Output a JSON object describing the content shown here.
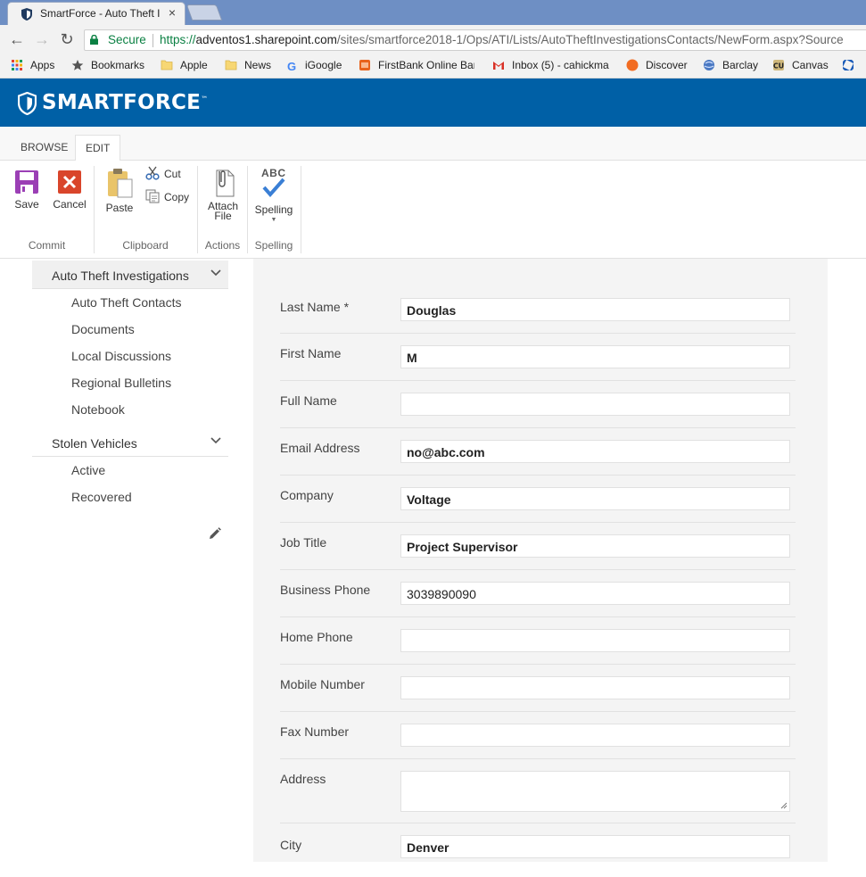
{
  "browser": {
    "tab_title": "SmartForce - Auto Theft I",
    "url_secure": "Secure",
    "url_scheme": "https://",
    "url_host": "adventos1.sharepoint.com",
    "url_path": "/sites/smartforce2018-1/Ops/ATI/Lists/AutoTheftInvestigationsContacts/NewForm.aspx?Source",
    "bookmarks": [
      {
        "label": "Apps",
        "icon": "apps-grid-icon"
      },
      {
        "label": "Bookmarks",
        "icon": "star-icon"
      },
      {
        "label": "Apple",
        "icon": "folder-icon"
      },
      {
        "label": "News",
        "icon": "folder-icon"
      },
      {
        "label": "iGoogle",
        "icon": "google-icon"
      },
      {
        "label": "FirstBank Online Ban",
        "icon": "firstbank-icon"
      },
      {
        "label": "Inbox (5) - cahickma",
        "icon": "gmail-icon"
      },
      {
        "label": "Discover",
        "icon": "discover-icon"
      },
      {
        "label": "Barclay",
        "icon": "globe-icon"
      },
      {
        "label": "Canvas",
        "icon": "cu-icon"
      }
    ]
  },
  "suite": {
    "brand": "SMARTFORCE",
    "trademark": "™"
  },
  "ribbon": {
    "tabs": [
      "BROWSE",
      "EDIT"
    ],
    "active_tab": "EDIT",
    "save": "Save",
    "cancel": "Cancel",
    "paste": "Paste",
    "cut": "Cut",
    "copy": "Copy",
    "attach_line1": "Attach",
    "attach_line2": "File",
    "spelling": "Spelling",
    "spelling_icon_text": "ABC",
    "groups": [
      "Commit",
      "Clipboard",
      "Actions",
      "Spelling"
    ]
  },
  "leftnav": {
    "section1": "Auto Theft Investigations",
    "section1_items": [
      "Auto Theft Contacts",
      "Documents",
      "Local Discussions",
      "Regional Bulletins",
      "Notebook"
    ],
    "section2": "Stolen Vehicles",
    "section2_items": [
      "Active",
      "Recovered"
    ]
  },
  "form": {
    "fields": [
      {
        "label": "Last Name *",
        "value": "Douglas"
      },
      {
        "label": "First Name",
        "value": "M"
      },
      {
        "label": "Full Name",
        "value": ""
      },
      {
        "label": "Email Address",
        "value": "no@abc.com"
      },
      {
        "label": "Company",
        "value": "Voltage"
      },
      {
        "label": "Job Title",
        "value": "Project Supervisor"
      },
      {
        "label": "Business Phone",
        "value": "3039890090"
      },
      {
        "label": "Home Phone",
        "value": ""
      },
      {
        "label": "Mobile Number",
        "value": ""
      },
      {
        "label": "Fax Number",
        "value": ""
      },
      {
        "label": "Address",
        "value": ""
      },
      {
        "label": "City",
        "value": "Denver"
      }
    ]
  },
  "colors": {
    "suite_blue": "#0060a6",
    "secure_green": "#0b8043",
    "save_purple": "#9b3fb5",
    "cancel_red": "#d9452b"
  }
}
